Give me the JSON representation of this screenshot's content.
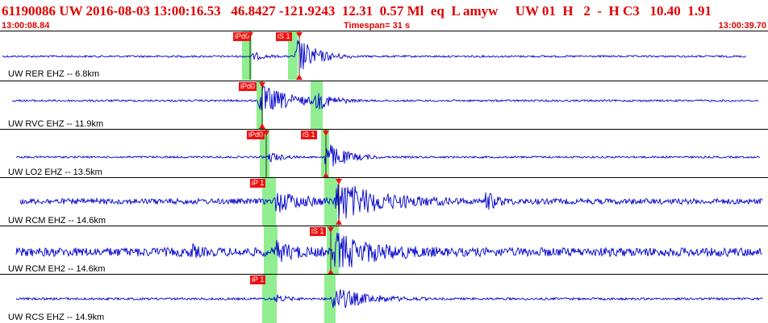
{
  "header": {
    "title": "61190086 UW 2016-08-03 13:00:16.53   46.8427 -121.9243  12.31  0.57 Ml  eq  L amyw     UW 01  H   2  -  H C3   10.40  1.91",
    "start_time": "13:00:08.84",
    "timespan": "Timespan=  31 s",
    "end_time": "13:00:39.70"
  },
  "colors": {
    "trace": "#0000cc",
    "pick": "#ee1111",
    "window": "#90ee90",
    "title": "#e00000"
  },
  "channels": [
    {
      "label": "UW RER EHZ -- 6.8km",
      "picks": [
        {
          "text": "iPd0"
        },
        {
          "text": "iS 1"
        }
      ]
    },
    {
      "label": "UW RVC EHZ -- 11.9km",
      "picks": [
        {
          "text": "iPd0"
        }
      ]
    },
    {
      "label": "UW LO2 EHZ -- 13.5km",
      "picks": [
        {
          "text": "iPd0"
        },
        {
          "text": "iS 1"
        }
      ]
    },
    {
      "label": "UW RCM EHZ -- 14.6km",
      "picks": [
        {
          "text": "iP 1"
        }
      ]
    },
    {
      "label": "UW RCM EH2 -- 14.6km",
      "picks": [
        {
          "text": "iS 1"
        }
      ]
    },
    {
      "label": "UW RCS EHZ -- 14.9km",
      "picks": [
        {
          "text": "iP 1"
        }
      ]
    }
  ]
}
